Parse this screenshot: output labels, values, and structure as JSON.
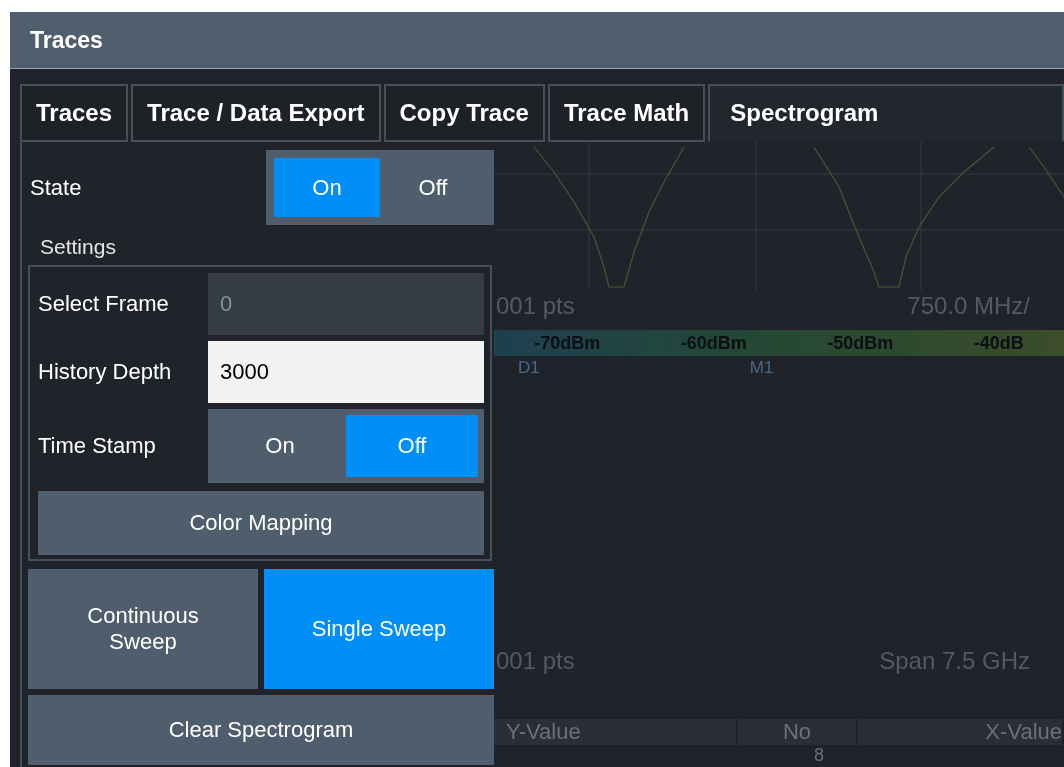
{
  "window": {
    "title": "Traces"
  },
  "tabs": [
    {
      "label": "Traces",
      "selected": false
    },
    {
      "label": "Trace / Data Export",
      "selected": false
    },
    {
      "label": "Copy Trace",
      "selected": false
    },
    {
      "label": "Trace Math",
      "selected": false
    },
    {
      "label": "Spectrogram",
      "selected": true
    }
  ],
  "state": {
    "label": "State",
    "options": [
      {
        "label": "On",
        "selected": true
      },
      {
        "label": "Off",
        "selected": false
      }
    ]
  },
  "settings": {
    "title": "Settings",
    "select_frame": {
      "label": "Select Frame",
      "value": "0",
      "disabled": true
    },
    "history_depth": {
      "label": "History Depth",
      "value": "3000",
      "disabled": false
    },
    "time_stamp": {
      "label": "Time Stamp",
      "options": [
        {
          "label": "On",
          "selected": false
        },
        {
          "label": "Off",
          "selected": true
        }
      ]
    },
    "color_mapping": "Color Mapping"
  },
  "sweep_buttons": [
    {
      "label": "Continuous Sweep",
      "selected": false
    },
    {
      "label": "Single Sweep",
      "selected": true
    }
  ],
  "clear_button": "Clear Spectrogram",
  "background": {
    "points_top": "001 pts",
    "scale": "750.0 MHz/",
    "color_bar": [
      "-70dBm",
      "-60dBm",
      "-50dBm",
      "-40dB"
    ],
    "markers": [
      "D1",
      "M1"
    ],
    "points_bottom": "001 pts",
    "span": "Span 7.5 GHz",
    "table_columns": [
      "Y-Value",
      "No",
      "X-Value"
    ],
    "table_row": [
      "8"
    ]
  }
}
